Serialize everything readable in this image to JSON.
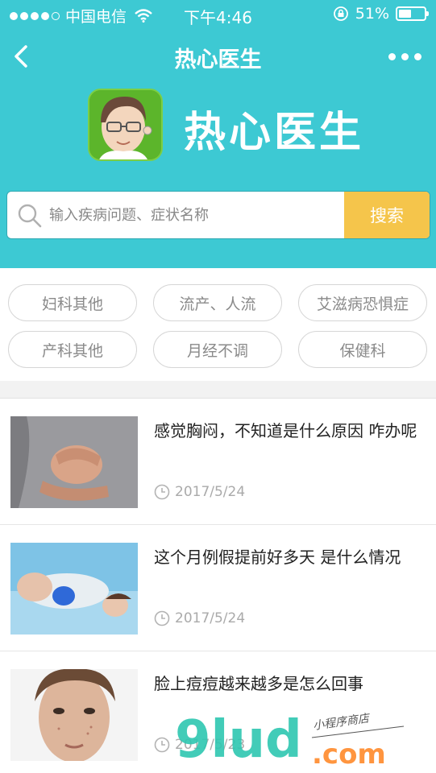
{
  "status_bar": {
    "carrier": "中国电信",
    "time": "下午4:46",
    "battery": "51%",
    "battery_level": 0.51
  },
  "nav": {
    "title": "热心医生"
  },
  "brand": {
    "name": "热心医生"
  },
  "search": {
    "placeholder": "输入疾病问题、症状名称",
    "button_label": "搜索"
  },
  "tags": [
    "妇科其他",
    "流产、人流",
    "艾滋病恐惧症",
    "产科其他",
    "月经不调",
    "保健科"
  ],
  "articles": [
    {
      "title": "感觉胸闷，不知道是什么原因 咋办呢",
      "date": "2017/5/24"
    },
    {
      "title": "这个月例假提前好多天 是什么情况",
      "date": "2017/5/24"
    },
    {
      "title": "脸上痘痘越来越多是怎么回事",
      "date": "2017/5/23"
    }
  ],
  "watermark": {
    "main": "9lud",
    "sub": ".com",
    "tagline": "小程序商店"
  },
  "colors": {
    "header": "#3dc9d3",
    "search_button": "#f5c54b"
  }
}
